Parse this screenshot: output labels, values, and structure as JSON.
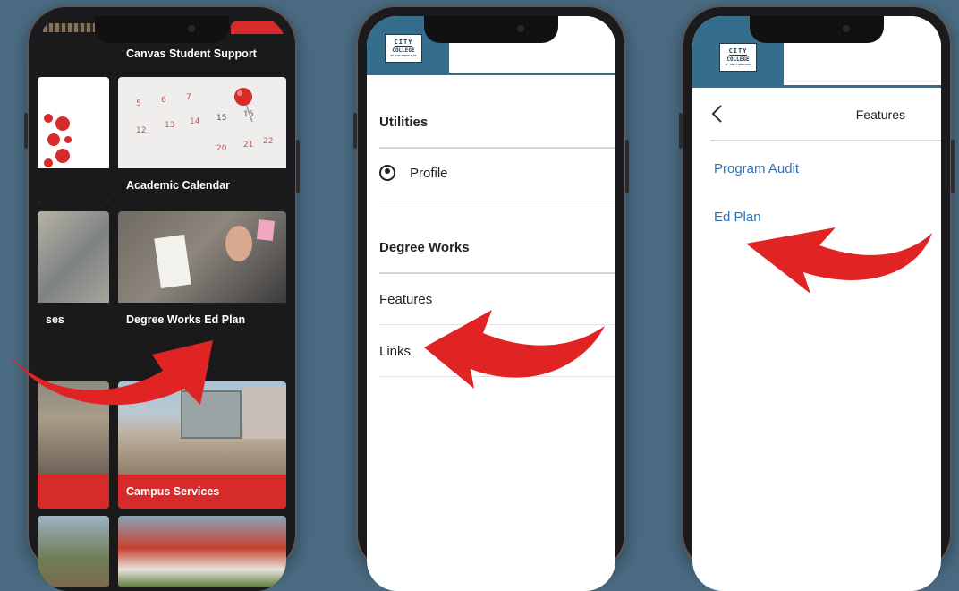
{
  "phone1": {
    "tiles": [
      {
        "label": "Canvas Student Support"
      },
      {
        "label": "Academic Calendar"
      },
      {
        "label": "ses"
      },
      {
        "label": "Degree Works Ed Plan"
      },
      {
        "label": "Campus Services"
      }
    ]
  },
  "phone2": {
    "sections": [
      {
        "title": "Utilities",
        "items": [
          "Profile"
        ]
      },
      {
        "title": "Degree Works",
        "items": [
          "Features",
          "Links"
        ]
      }
    ]
  },
  "phone3": {
    "header_title": "Features",
    "back_icon": "chevron-left-icon",
    "links": [
      "Program Audit",
      "Ed Plan"
    ]
  },
  "logo": {
    "line1": "CITY",
    "line2": "COLLEGE",
    "line3": "OF SAN FRANCISCO"
  },
  "colors": {
    "background": "#4a6b82",
    "brand_blue": "#356e8d",
    "accent_red": "#d72b2b",
    "link_blue": "#2c72b8",
    "arrow_red": "#e02424"
  }
}
